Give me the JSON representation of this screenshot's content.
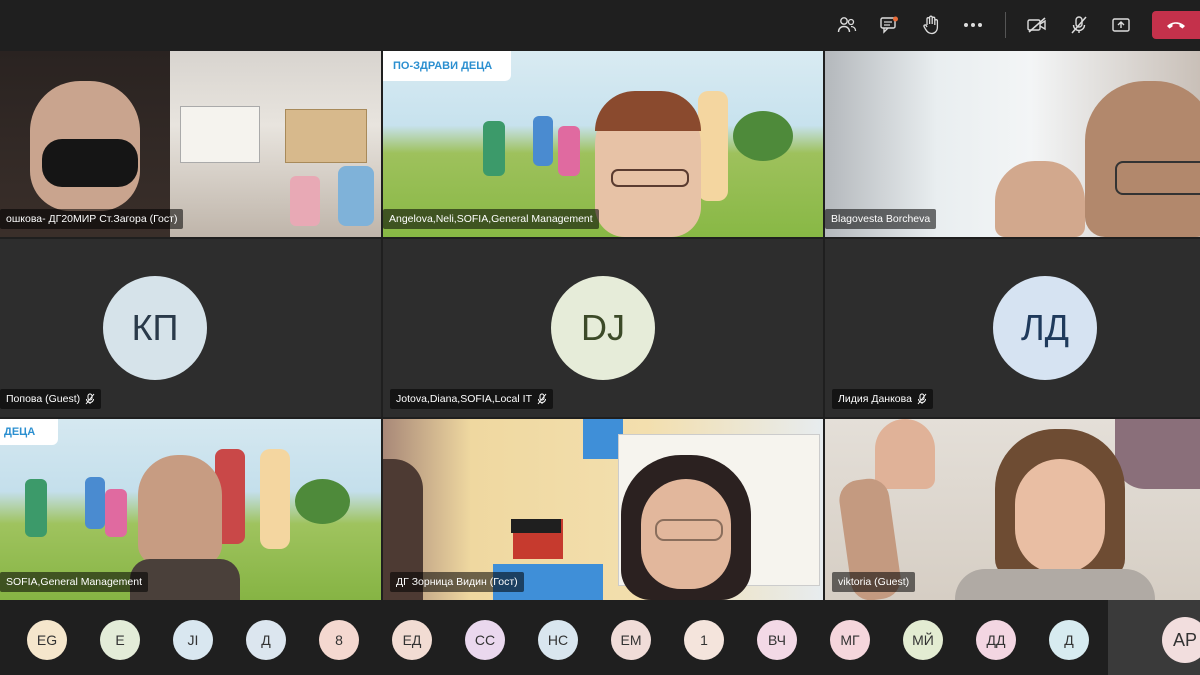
{
  "toolbar": {
    "icons": [
      "participants-icon",
      "chat-icon",
      "raise-hand-icon",
      "more-actions-icon",
      "camera-off-icon",
      "mic-off-icon",
      "share-screen-icon",
      "hang-up-icon"
    ]
  },
  "tiles": [
    {
      "name": "ошкова- ДГ20МИР Ст.Загора (Гост)",
      "type": "video"
    },
    {
      "name": "Angelova,Neli,SOFIA,General Management",
      "type": "video",
      "banner": "ПО-ЗДРАВИ ДЕЦА"
    },
    {
      "name": "Blagovesta Borcheva",
      "type": "video"
    },
    {
      "name": "Попова (Guest)",
      "type": "avatar",
      "initials": "КП",
      "color": "#d6e3ea",
      "muted": true
    },
    {
      "name": "Jotova,Diana,SOFIA,Local IT",
      "type": "avatar",
      "initials": "DJ",
      "color": "#e6ecd9",
      "muted": true
    },
    {
      "name": "Лидия Данкова",
      "type": "avatar",
      "initials": "ЛД",
      "color": "#d6e3f2",
      "muted": true
    },
    {
      "name": "SOFIA,General Management",
      "type": "video",
      "banner": "ДЕЦА"
    },
    {
      "name": "ДГ Зорница Видин (Гост)",
      "type": "video"
    },
    {
      "name": "viktoria (Guest)",
      "type": "video"
    }
  ],
  "overflow": [
    {
      "initials": "EG",
      "color": "#f5e6cc"
    },
    {
      "initials": "E",
      "color": "#e3ecd8"
    },
    {
      "initials": "JI",
      "color": "#d9e7f0"
    },
    {
      "initials": "Д",
      "color": "#dce6ef"
    },
    {
      "initials": "8",
      "color": "#f4d8d0"
    },
    {
      "initials": "ЕД",
      "color": "#f2dcd3"
    },
    {
      "initials": "СС",
      "color": "#ead8ee"
    },
    {
      "initials": "НС",
      "color": "#d9e6ef"
    },
    {
      "initials": "ЕМ",
      "color": "#f0dcd8"
    },
    {
      "initials": "1",
      "color": "#f4e4dc"
    },
    {
      "initials": "ВЧ",
      "color": "#f3d9e6"
    },
    {
      "initials": "МГ",
      "color": "#f5d6dc"
    },
    {
      "initials": "МЙ",
      "color": "#e3ecd2"
    },
    {
      "initials": "ДД",
      "color": "#f3d6e2"
    },
    {
      "initials": "Д",
      "color": "#d7ebf0"
    }
  ],
  "overflow_extra": {
    "initials": "АР"
  }
}
